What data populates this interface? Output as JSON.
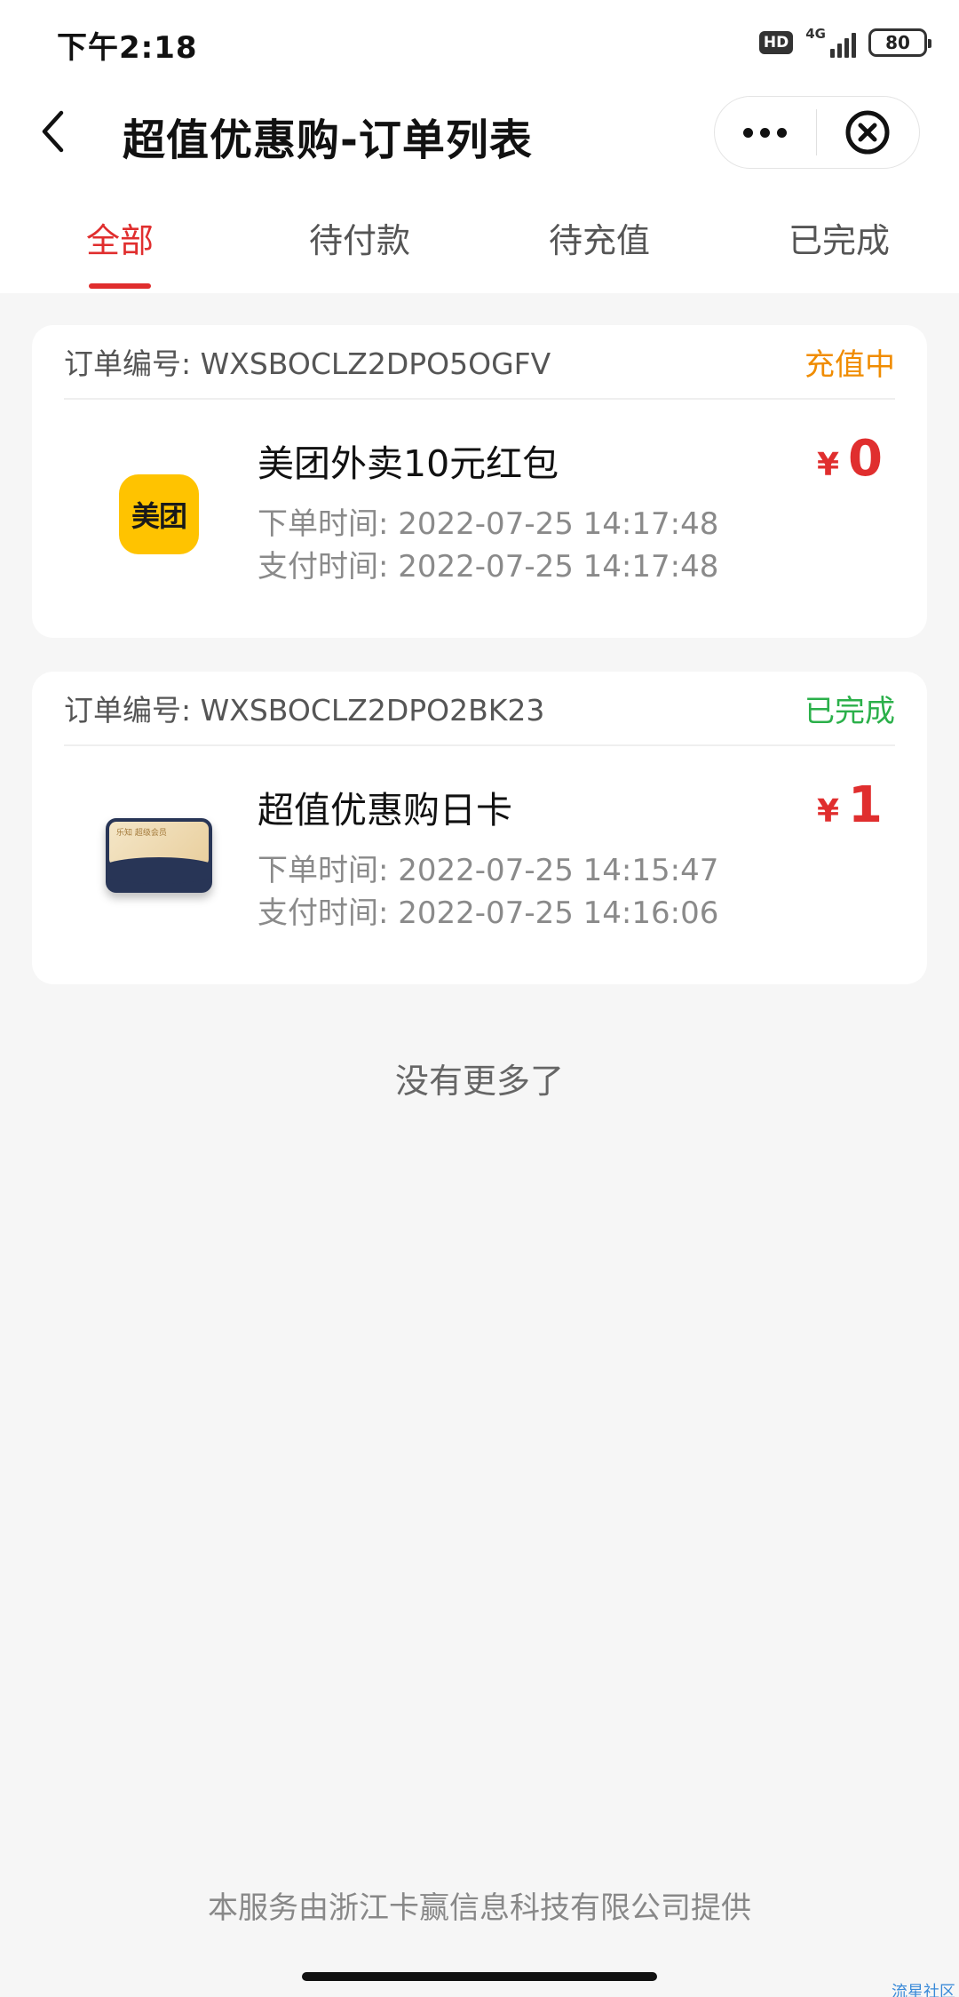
{
  "status_bar": {
    "time": "下午2:18",
    "hd": "HD",
    "network": "4G",
    "battery": "80"
  },
  "nav": {
    "title": "超值优惠购-订单列表"
  },
  "tabs": [
    {
      "label": "全部",
      "active": true
    },
    {
      "label": "待付款",
      "active": false
    },
    {
      "label": "待充值",
      "active": false
    },
    {
      "label": "已完成",
      "active": false
    }
  ],
  "orders": [
    {
      "order_no": "订单编号: WXSBOCLZ2DPO5OGFV",
      "status": "充值中",
      "status_color": "#f08c00",
      "logo_text": "美团",
      "name": "美团外卖10元红包",
      "order_time": "下单时间: 2022-07-25 14:17:48",
      "pay_time": "支付时间: 2022-07-25 14:17:48",
      "currency": "¥",
      "price": "0"
    },
    {
      "order_no": "订单编号: WXSBOCLZ2DPO2BK23",
      "status": "已完成",
      "status_color": "#2bb04a",
      "logo_text": "乐知 超级会员",
      "name": "超值优惠购日卡",
      "order_time": "下单时间: 2022-07-25 14:15:47",
      "pay_time": "支付时间: 2022-07-25 14:16:06",
      "currency": "¥",
      "price": "1"
    }
  ],
  "no_more": "没有更多了",
  "footer": "本服务由浙江卡赢信息科技有限公司提供",
  "watermark": "流星社区",
  "colors": {
    "accent": "#e02e2e",
    "background": "#f6f6f6"
  }
}
